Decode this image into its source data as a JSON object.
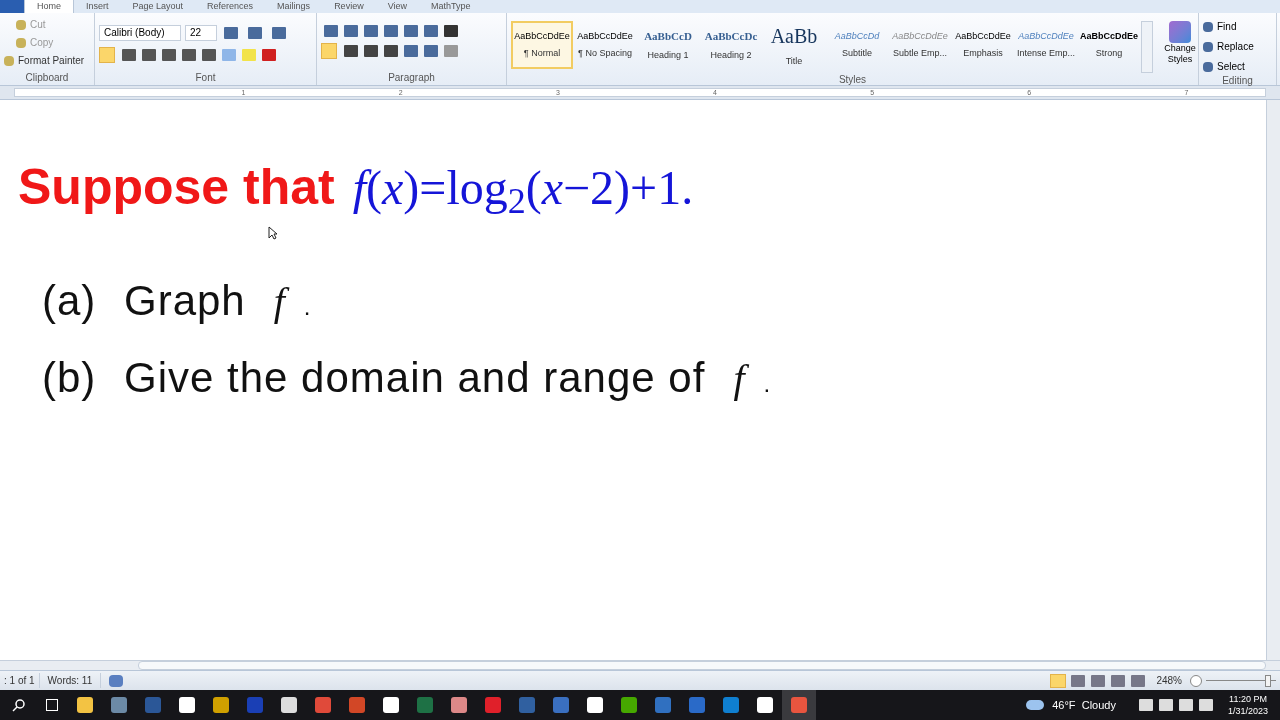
{
  "ribbon_tabs": [
    {
      "label": "Home",
      "selected": true
    },
    {
      "label": "Insert",
      "selected": false
    },
    {
      "label": "Page Layout",
      "selected": false
    },
    {
      "label": "References",
      "selected": false
    },
    {
      "label": "Mailings",
      "selected": false
    },
    {
      "label": "Review",
      "selected": false
    },
    {
      "label": "View",
      "selected": false
    },
    {
      "label": "MathType",
      "selected": false
    }
  ],
  "clipboard": {
    "items": [
      "Cut",
      "Copy",
      "Format Painter"
    ],
    "label": "Clipboard"
  },
  "font": {
    "name": "Calibri (Body)",
    "size": "22",
    "label": "Font",
    "bold": true
  },
  "paragraph": {
    "label": "Paragraph",
    "align_left": true
  },
  "styles": {
    "label": "Styles",
    "items": [
      {
        "sample": "AaBbCcDdEe",
        "name": "¶ Normal",
        "selected": true
      },
      {
        "sample": "AaBbCcDdEe",
        "name": "¶ No Spacing",
        "selected": false
      },
      {
        "sample": "AaBbCcD",
        "name": "Heading 1",
        "selected": false
      },
      {
        "sample": "AaBbCcDc",
        "name": "Heading 2",
        "selected": false
      },
      {
        "sample": "AaBb",
        "name": "Title",
        "selected": false
      },
      {
        "sample": "AaBbCcDd",
        "name": "Subtitle",
        "selected": false
      },
      {
        "sample": "AaBbCcDdEe",
        "name": "Subtle Emp...",
        "selected": false
      },
      {
        "sample": "AaBbCcDdEe",
        "name": "Emphasis",
        "selected": false
      },
      {
        "sample": "AaBbCcDdEe",
        "name": "Intense Emp...",
        "selected": false
      },
      {
        "sample": "AaBbCcDdEe",
        "name": "Strong",
        "selected": false
      }
    ],
    "change_styles": "Change Styles"
  },
  "editing": {
    "label": "Editing",
    "items": [
      "Find",
      "Replace",
      "Select"
    ]
  },
  "ruler": {
    "numbers": [
      "1",
      "2",
      "3",
      "4",
      "5",
      "6",
      "7"
    ]
  },
  "document": {
    "heading": "Suppose that",
    "formula": "*f*(*x*)=log$_{2}$(*x*−2)+1.",
    "items": [
      {
        "label": "(a)",
        "text": "Graph",
        "math": "f",
        "end": "."
      },
      {
        "label": "(b)",
        "text": "Give the domain and range of",
        "math": "f",
        "end": "."
      }
    ]
  },
  "status_bar": {
    "page": ": 1 of 1",
    "words": "Words: 11",
    "zoom": "248%",
    "zoom_slider": {
      "level": 0.88
    }
  },
  "taskbar": {
    "weather": "46°F  Cloudy",
    "time": "11:20 PM",
    "date": "1/31/2023"
  }
}
